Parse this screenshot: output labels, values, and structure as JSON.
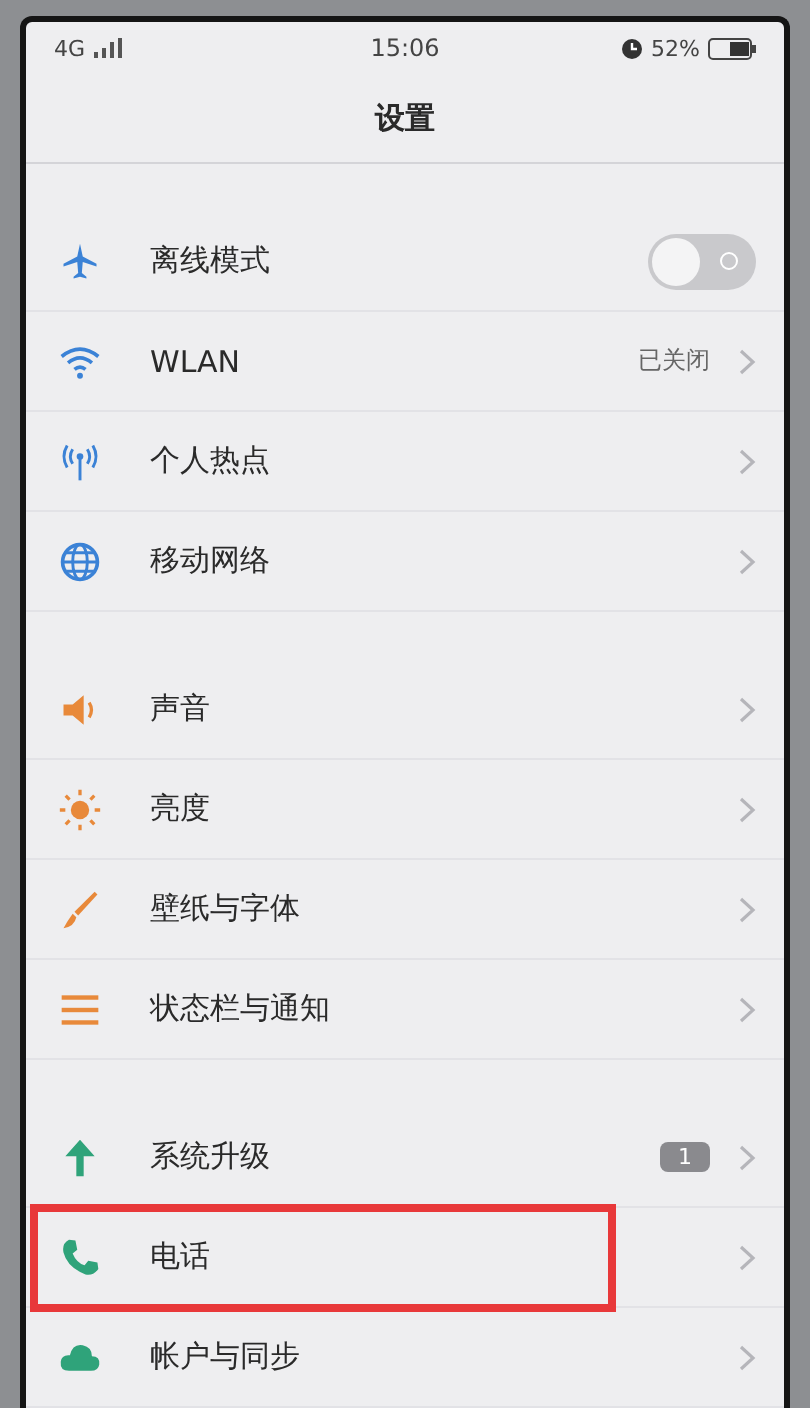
{
  "status_bar": {
    "network": "4G",
    "time": "15:06",
    "battery_percent": "52%"
  },
  "title": "设置",
  "groups": [
    {
      "items": [
        {
          "kind": "toggle",
          "label": "离线模式",
          "on": false,
          "highlighted": false
        },
        {
          "kind": "link",
          "label": "WLAN",
          "value": "已关闭",
          "highlighted": false
        },
        {
          "kind": "link",
          "label": "个人热点",
          "highlighted": false
        },
        {
          "kind": "link",
          "label": "移动网络",
          "highlighted": false
        }
      ]
    },
    {
      "items": [
        {
          "kind": "link",
          "label": "声音",
          "highlighted": false
        },
        {
          "kind": "link",
          "label": "亮度",
          "highlighted": false
        },
        {
          "kind": "link",
          "label": "壁纸与字体",
          "highlighted": false
        },
        {
          "kind": "link",
          "label": "状态栏与通知",
          "highlighted": false
        }
      ]
    },
    {
      "items": [
        {
          "kind": "link",
          "label": "系统升级",
          "badge": "1",
          "highlighted": false
        },
        {
          "kind": "link",
          "label": "电话",
          "highlighted": true
        },
        {
          "kind": "link",
          "label": "帐户与同步",
          "highlighted": false
        }
      ]
    }
  ]
}
